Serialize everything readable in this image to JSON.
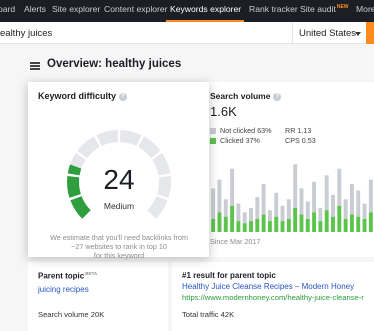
{
  "nav": {
    "items": [
      {
        "label": "oard"
      },
      {
        "label": "Alerts"
      },
      {
        "label": "Site explorer"
      },
      {
        "label": "Content explorer"
      },
      {
        "label": "Keywords explorer"
      },
      {
        "label": "Rank tracker"
      },
      {
        "label": "Site audit"
      },
      {
        "label": "More"
      }
    ],
    "new_badge": "NEW",
    "accent": "#ff8a1e"
  },
  "search": {
    "query": "ealthy juices",
    "country": "United States"
  },
  "overview": {
    "title": "Overview: healthy juices"
  },
  "keyword_difficulty": {
    "title": "Keyword difficulty",
    "value": "24",
    "score": 24,
    "label": "Medium",
    "note_line1": "We estimate that you'll need backlinks from",
    "note_line2": "~27 websites to rank in top 10",
    "note_line3": "for this keyword",
    "gauge_fill_color": "#2e9e3e",
    "gauge_track_color": "#e6e7ea"
  },
  "search_volume": {
    "title": "Search volume",
    "value": "1.6K",
    "not_clicked": "Not clicked 63%",
    "clicked": "Clicked 37%",
    "rr": "RR 1.13",
    "cps": "CPS 0.53",
    "since": "Since Mar 2017",
    "colors": {
      "clicked": "#5cc44c",
      "not_clicked": "#c9ccd2"
    },
    "bars": [
      {
        "total": 40,
        "clicked": 12
      },
      {
        "total": 48,
        "clicked": 18
      },
      {
        "total": 30,
        "clicked": 14
      },
      {
        "total": 58,
        "clicked": 24
      },
      {
        "total": 26,
        "clicked": 10
      },
      {
        "total": 18,
        "clicked": 8
      },
      {
        "total": 22,
        "clicked": 10
      },
      {
        "total": 32,
        "clicked": 12
      },
      {
        "total": 44,
        "clicked": 16
      },
      {
        "total": 20,
        "clicked": 10
      },
      {
        "total": 36,
        "clicked": 14
      },
      {
        "total": 24,
        "clicked": 10
      },
      {
        "total": 30,
        "clicked": 12
      },
      {
        "total": 62,
        "clicked": 22
      },
      {
        "total": 40,
        "clicked": 16
      },
      {
        "total": 28,
        "clicked": 12
      },
      {
        "total": 46,
        "clicked": 18
      },
      {
        "total": 22,
        "clicked": 10
      },
      {
        "total": 52,
        "clicked": 20
      },
      {
        "total": 34,
        "clicked": 14
      },
      {
        "total": 58,
        "clicked": 24
      },
      {
        "total": 30,
        "clicked": 12
      },
      {
        "total": 44,
        "clicked": 16
      },
      {
        "total": 38,
        "clicked": 14
      },
      {
        "total": 26,
        "clicked": 12
      },
      {
        "total": 48,
        "clicked": 18
      }
    ]
  },
  "parent_topic": {
    "title": "Parent topic",
    "badge": "BETA",
    "link": "juicing recipes",
    "volume": "Search volume 20K"
  },
  "first_result": {
    "title": "#1 result for parent topic",
    "link": "Healthy Juice Cleanse Recipes – Modern Honey",
    "url": "https://www.modernhoney.com/healthy-juice-cleanse-r",
    "traffic": "Total traffic 42K"
  }
}
